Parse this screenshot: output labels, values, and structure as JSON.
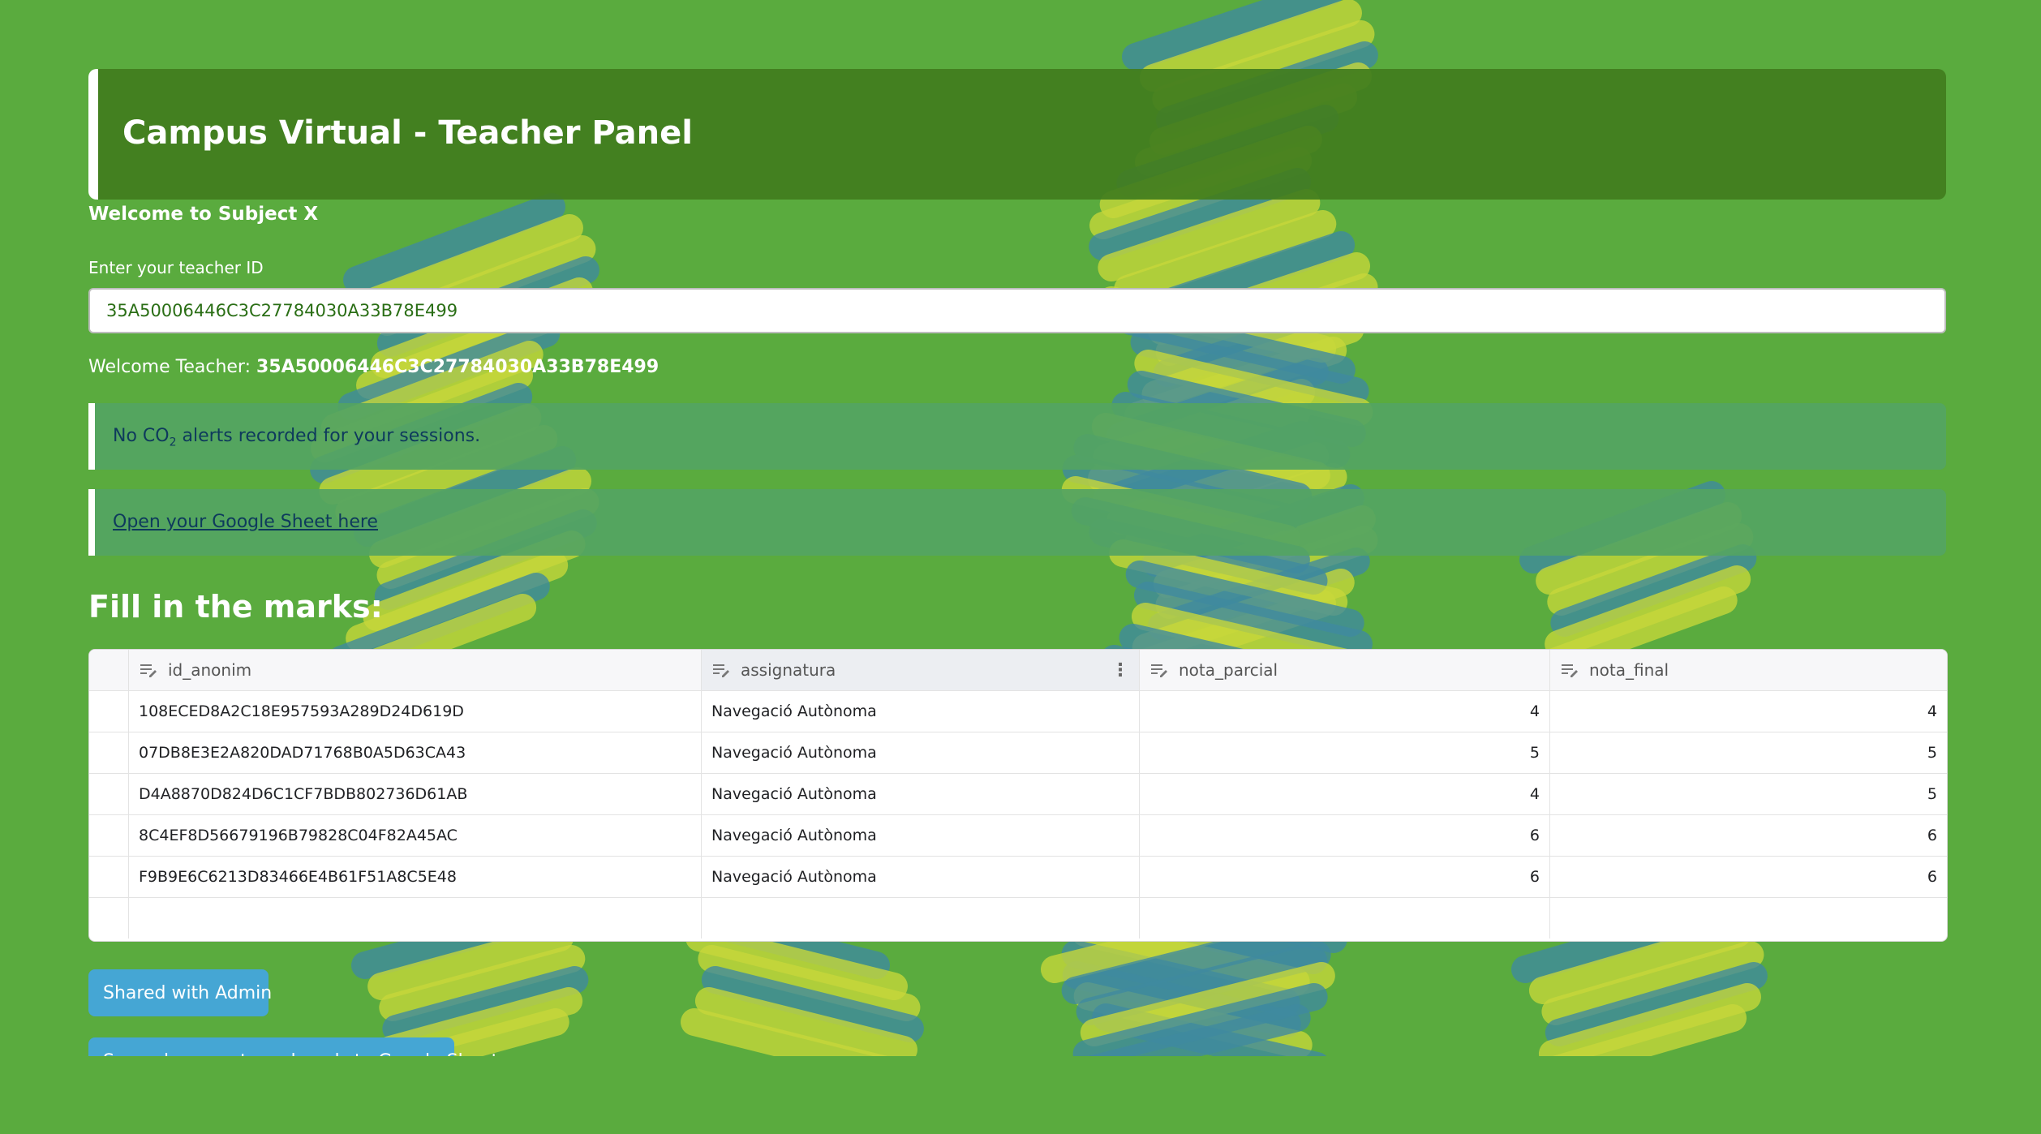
{
  "header": {
    "title": "Campus Virtual - Teacher Panel"
  },
  "subtitle": "Welcome to Subject X",
  "teacher_id_field": {
    "label": "Enter your teacher ID",
    "value": "35A50006446C3C27784030A33B78E499"
  },
  "welcome": {
    "prefix": "Welcome Teacher:",
    "teacher_id": "35A50006446C3C27784030A33B78E499"
  },
  "alerts": {
    "co2_before": "No CO",
    "co2_sub": "2",
    "co2_after": " alerts recorded for your sessions.",
    "sheet_link": "Open your Google Sheet here"
  },
  "marks": {
    "heading": "Fill in the marks:",
    "columns": [
      "id_anonim",
      "assignatura",
      "nota_parcial",
      "nota_final"
    ],
    "rows": [
      [
        "108ECED8A2C18E957593A289D24D619D",
        "Navegació Autònoma",
        "4",
        "4"
      ],
      [
        "07DB8E3E2A820DAD71768B0A5D63CA43",
        "Navegació Autònoma",
        "5",
        "5"
      ],
      [
        "D4A8870D824D6C1CF7BDB802736D61AB",
        "Navegació Autònoma",
        "4",
        "5"
      ],
      [
        "8C4EF8D56679196B79828C04F82A45AC",
        "Navegació Autònoma",
        "6",
        "6"
      ],
      [
        "F9B9E6C6213D83466E4B61F51A8C5E48",
        "Navegació Autònoma",
        "6",
        "6"
      ]
    ]
  },
  "buttons": {
    "shared": "Shared with Admin",
    "save": "Save placements and goals to Google Sheet"
  },
  "icons": {
    "column_type": "text-edit-icon",
    "column_menu": "column-menu-icon"
  },
  "colors": {
    "background": "#5aab3e",
    "header": "#427d1e",
    "alert": "#54a462",
    "button": "#45a6d4",
    "decor_yellow": "#c8d83a",
    "decor_blue": "#3f8aa0"
  }
}
